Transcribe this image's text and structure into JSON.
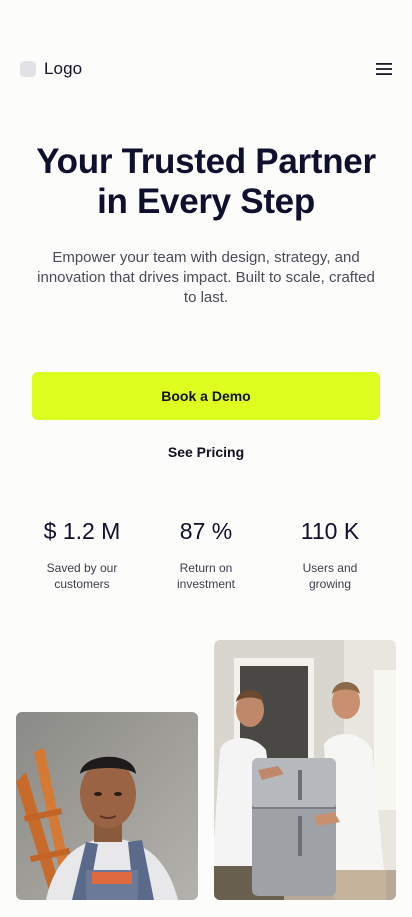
{
  "header": {
    "logo_text": "Logo",
    "menu_icon": "hamburger-menu-icon"
  },
  "hero": {
    "title_line1": "Your Trusted Partner",
    "title_line2": "in Every Step",
    "subtitle": "Empower your team with design, strategy, and innovation that drives impact. Built to scale, crafted to last."
  },
  "actions": {
    "primary_label": "Book a Demo",
    "secondary_label": "See Pricing"
  },
  "stats": [
    {
      "value": "$ 1.2 M",
      "label_line1": "Saved by our",
      "label_line2": "customers"
    },
    {
      "value": "87 %",
      "label_line1": "Return on",
      "label_line2": "investment"
    },
    {
      "value": "110 K",
      "label_line1": "Users and",
      "label_line2": "growing"
    }
  ],
  "colors": {
    "accent": "#dcff1f",
    "text_dark": "#0f0f2e",
    "background": "#fcfcfa"
  }
}
